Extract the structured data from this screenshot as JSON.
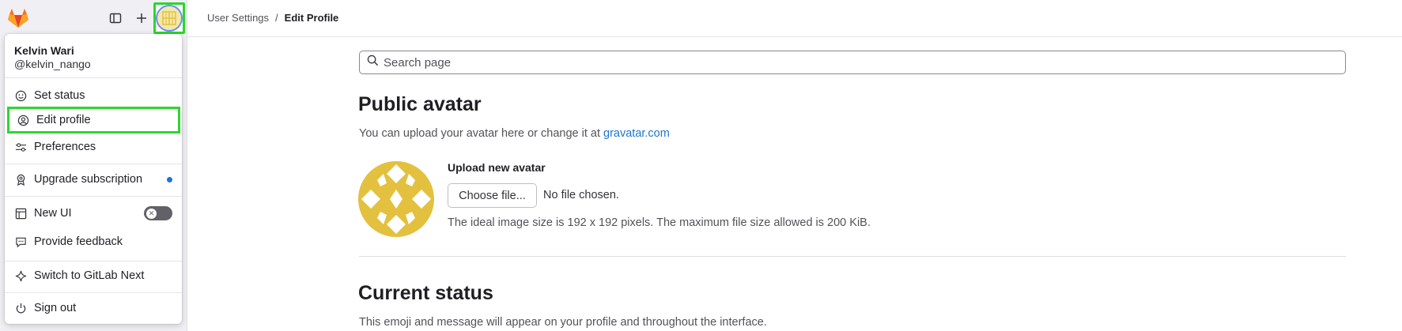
{
  "header": {
    "breadcrumb": [
      "User Settings",
      "/",
      "Edit Profile"
    ]
  },
  "user_menu": {
    "name": "Kelvin Wari",
    "handle": "@kelvin_nango",
    "items": [
      {
        "label": "Set status",
        "icon": "smiley-icon"
      },
      {
        "label": "Edit profile",
        "icon": "user-circle-icon"
      },
      {
        "label": "Preferences",
        "icon": "preferences-icon"
      },
      {
        "label": "Upgrade subscription",
        "icon": "badge-icon"
      },
      {
        "label": "New UI",
        "icon": "layout-icon"
      },
      {
        "label": "Provide feedback",
        "icon": "comment-icon"
      },
      {
        "label": "Switch to GitLab Next",
        "icon": "sparkle-icon"
      },
      {
        "label": "Sign out",
        "icon": "power-icon"
      }
    ],
    "new_ui_toggle": "off"
  },
  "search": {
    "placeholder": "Search page"
  },
  "public_avatar": {
    "title": "Public avatar",
    "description": "You can upload your avatar here or change it at ",
    "link": "gravatar.com",
    "upload_label": "Upload new avatar",
    "choose_button": "Choose file...",
    "no_file": "No file chosen.",
    "help": "The ideal image size is 192 x 192 pixels. The maximum file size allowed is 200 KiB."
  },
  "current_status": {
    "title": "Current status",
    "description": "This emoji and message will appear on your profile and throughout the interface."
  },
  "colors": {
    "highlight": "#2dd62d",
    "avatar_gold": "#e3c13f",
    "link": "#1f75cb"
  }
}
